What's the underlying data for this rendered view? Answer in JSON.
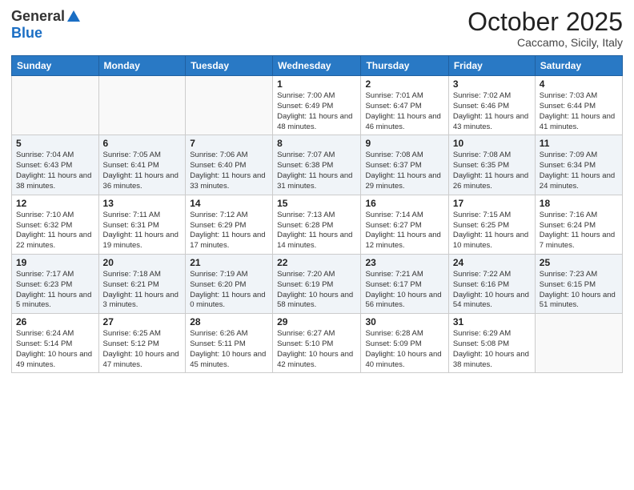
{
  "logo": {
    "general": "General",
    "blue": "Blue"
  },
  "title": "October 2025",
  "location": "Caccamo, Sicily, Italy",
  "days_of_week": [
    "Sunday",
    "Monday",
    "Tuesday",
    "Wednesday",
    "Thursday",
    "Friday",
    "Saturday"
  ],
  "weeks": [
    [
      {
        "day": "",
        "info": ""
      },
      {
        "day": "",
        "info": ""
      },
      {
        "day": "",
        "info": ""
      },
      {
        "day": "1",
        "info": "Sunrise: 7:00 AM\nSunset: 6:49 PM\nDaylight: 11 hours\nand 48 minutes."
      },
      {
        "day": "2",
        "info": "Sunrise: 7:01 AM\nSunset: 6:47 PM\nDaylight: 11 hours\nand 46 minutes."
      },
      {
        "day": "3",
        "info": "Sunrise: 7:02 AM\nSunset: 6:46 PM\nDaylight: 11 hours\nand 43 minutes."
      },
      {
        "day": "4",
        "info": "Sunrise: 7:03 AM\nSunset: 6:44 PM\nDaylight: 11 hours\nand 41 minutes."
      }
    ],
    [
      {
        "day": "5",
        "info": "Sunrise: 7:04 AM\nSunset: 6:43 PM\nDaylight: 11 hours\nand 38 minutes."
      },
      {
        "day": "6",
        "info": "Sunrise: 7:05 AM\nSunset: 6:41 PM\nDaylight: 11 hours\nand 36 minutes."
      },
      {
        "day": "7",
        "info": "Sunrise: 7:06 AM\nSunset: 6:40 PM\nDaylight: 11 hours\nand 33 minutes."
      },
      {
        "day": "8",
        "info": "Sunrise: 7:07 AM\nSunset: 6:38 PM\nDaylight: 11 hours\nand 31 minutes."
      },
      {
        "day": "9",
        "info": "Sunrise: 7:08 AM\nSunset: 6:37 PM\nDaylight: 11 hours\nand 29 minutes."
      },
      {
        "day": "10",
        "info": "Sunrise: 7:08 AM\nSunset: 6:35 PM\nDaylight: 11 hours\nand 26 minutes."
      },
      {
        "day": "11",
        "info": "Sunrise: 7:09 AM\nSunset: 6:34 PM\nDaylight: 11 hours\nand 24 minutes."
      }
    ],
    [
      {
        "day": "12",
        "info": "Sunrise: 7:10 AM\nSunset: 6:32 PM\nDaylight: 11 hours\nand 22 minutes."
      },
      {
        "day": "13",
        "info": "Sunrise: 7:11 AM\nSunset: 6:31 PM\nDaylight: 11 hours\nand 19 minutes."
      },
      {
        "day": "14",
        "info": "Sunrise: 7:12 AM\nSunset: 6:29 PM\nDaylight: 11 hours\nand 17 minutes."
      },
      {
        "day": "15",
        "info": "Sunrise: 7:13 AM\nSunset: 6:28 PM\nDaylight: 11 hours\nand 14 minutes."
      },
      {
        "day": "16",
        "info": "Sunrise: 7:14 AM\nSunset: 6:27 PM\nDaylight: 11 hours\nand 12 minutes."
      },
      {
        "day": "17",
        "info": "Sunrise: 7:15 AM\nSunset: 6:25 PM\nDaylight: 11 hours\nand 10 minutes."
      },
      {
        "day": "18",
        "info": "Sunrise: 7:16 AM\nSunset: 6:24 PM\nDaylight: 11 hours\nand 7 minutes."
      }
    ],
    [
      {
        "day": "19",
        "info": "Sunrise: 7:17 AM\nSunset: 6:23 PM\nDaylight: 11 hours\nand 5 minutes."
      },
      {
        "day": "20",
        "info": "Sunrise: 7:18 AM\nSunset: 6:21 PM\nDaylight: 11 hours\nand 3 minutes."
      },
      {
        "day": "21",
        "info": "Sunrise: 7:19 AM\nSunset: 6:20 PM\nDaylight: 11 hours\nand 0 minutes."
      },
      {
        "day": "22",
        "info": "Sunrise: 7:20 AM\nSunset: 6:19 PM\nDaylight: 10 hours\nand 58 minutes."
      },
      {
        "day": "23",
        "info": "Sunrise: 7:21 AM\nSunset: 6:17 PM\nDaylight: 10 hours\nand 56 minutes."
      },
      {
        "day": "24",
        "info": "Sunrise: 7:22 AM\nSunset: 6:16 PM\nDaylight: 10 hours\nand 54 minutes."
      },
      {
        "day": "25",
        "info": "Sunrise: 7:23 AM\nSunset: 6:15 PM\nDaylight: 10 hours\nand 51 minutes."
      }
    ],
    [
      {
        "day": "26",
        "info": "Sunrise: 6:24 AM\nSunset: 5:14 PM\nDaylight: 10 hours\nand 49 minutes."
      },
      {
        "day": "27",
        "info": "Sunrise: 6:25 AM\nSunset: 5:12 PM\nDaylight: 10 hours\nand 47 minutes."
      },
      {
        "day": "28",
        "info": "Sunrise: 6:26 AM\nSunset: 5:11 PM\nDaylight: 10 hours\nand 45 minutes."
      },
      {
        "day": "29",
        "info": "Sunrise: 6:27 AM\nSunset: 5:10 PM\nDaylight: 10 hours\nand 42 minutes."
      },
      {
        "day": "30",
        "info": "Sunrise: 6:28 AM\nSunset: 5:09 PM\nDaylight: 10 hours\nand 40 minutes."
      },
      {
        "day": "31",
        "info": "Sunrise: 6:29 AM\nSunset: 5:08 PM\nDaylight: 10 hours\nand 38 minutes."
      },
      {
        "day": "",
        "info": ""
      }
    ]
  ]
}
